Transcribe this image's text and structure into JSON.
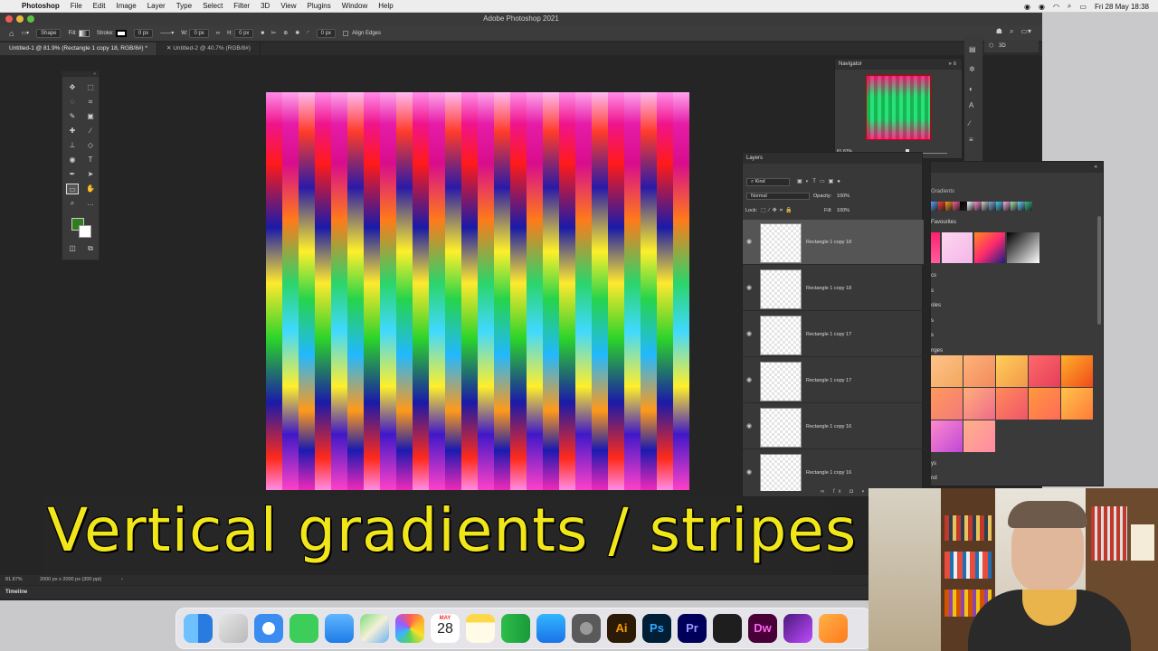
{
  "menubar": {
    "app": "Photoshop",
    "items": [
      "File",
      "Edit",
      "Image",
      "Layer",
      "Type",
      "Select",
      "Filter",
      "3D",
      "View",
      "Plugins",
      "Window",
      "Help"
    ],
    "clock": "Fri 28 May  18:38"
  },
  "window": {
    "title": "Adobe Photoshop 2021"
  },
  "options": {
    "mode": "Shape",
    "fill_label": "Fill:",
    "stroke_label": "Stroke:",
    "stroke_value": "0 px",
    "w_label": "W:",
    "w_value": "0 px",
    "h_label": "H:",
    "h_value": "0 px",
    "radius_value": "0 px",
    "align_edges": "Align Edges"
  },
  "tabs": [
    {
      "label": "Untitled-1 @ 81.9% (Rectangle 1 copy 18, RGB/8#) *"
    },
    {
      "label": "Untitled-2 @ 40.7% (RGB/8#)"
    }
  ],
  "navigator": {
    "title": "Navigator",
    "zoom": "81.87%"
  },
  "panel_3d": {
    "label": "3D"
  },
  "layers": {
    "title": "Layers",
    "kind": "Kind",
    "blend": "Normal",
    "opacity_label": "Opacity:",
    "opacity": "100%",
    "lock_label": "Lock:",
    "fill_label": "Fill:",
    "fill": "100%",
    "items": [
      {
        "name": "Rectangle 1 copy 18"
      },
      {
        "name": "Rectangle 1 copy 18"
      },
      {
        "name": "Rectangle 1 copy 17"
      },
      {
        "name": "Rectangle 1 copy 17"
      },
      {
        "name": "Rectangle 1 copy 16"
      },
      {
        "name": "Rectangle 1 copy 16"
      }
    ]
  },
  "gradients": {
    "title": "Gradients",
    "favourites": "Favourites",
    "groups": [
      "cs",
      "s",
      "oles",
      "s",
      "s",
      "nges",
      "ys",
      "nd"
    ]
  },
  "status": {
    "zoom": "81.87%",
    "doc": "2000 px x 2000 px (300 ppi)"
  },
  "timeline": {
    "label": "Timeline"
  },
  "caption": {
    "text": "Vertical gradients / stripes"
  },
  "dock": {
    "calendar_month": "MAY",
    "calendar_day": "28",
    "apps": [
      "Finder",
      "Launchpad",
      "Safari",
      "Messages",
      "Mail",
      "Maps",
      "Photos",
      "Calendar",
      "Notes",
      "Numbers",
      "App Store",
      "System Preferences",
      "Illustrator",
      "Photoshop",
      "Premiere Pro",
      "OBS",
      "Dreamweaver",
      "Affinity",
      "Pages"
    ],
    "labels": {
      "ai": "Ai",
      "ps": "Ps",
      "pr": "Pr",
      "dw": "Dw"
    }
  },
  "colors": {
    "accent_caption": "#f0e61a",
    "foreground_swatch": "#2f7d1d",
    "background_swatch": "#ffffff"
  }
}
